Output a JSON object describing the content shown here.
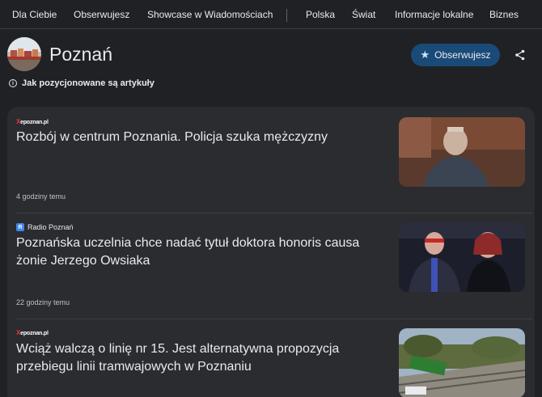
{
  "nav": {
    "items": [
      "Dla Ciebie",
      "Obserwujesz",
      "Showcase w Wiadomościach",
      "Polska",
      "Świat",
      "Informacje lokalne",
      "Biznes"
    ]
  },
  "topic": {
    "title": "Poznań",
    "follow_label": "Obserwujesz",
    "info_label": "Jak pozycjonowane są artykuły"
  },
  "articles": [
    {
      "source": "epoznan.pl",
      "headline": "Rozbój w centrum Poznania. Policja szuka mężczyzny",
      "time": "4 godziny temu"
    },
    {
      "source": "Radio Poznań",
      "headline": "Poznańska uczelnia chce nadać tytuł doktora honoris causa żonie Jerzego Owsiaka",
      "time": "22 godziny temu"
    },
    {
      "source": "epoznan.pl",
      "headline": "Wciąż walczą o linię nr 15. Jest alternatywna propozycja przebiegu linii tramwajowych w Poznaniu",
      "time": ""
    }
  ],
  "colors": {
    "background": "#202124",
    "card": "#2b2c2f",
    "follow_button": "#1a4a78",
    "text": "#e8eaed"
  }
}
